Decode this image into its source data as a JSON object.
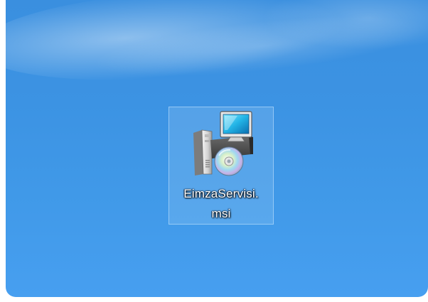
{
  "desktop": {
    "wallpaper_colors": [
      "#3a8fdf",
      "#479ff0"
    ],
    "icons": [
      {
        "icon_name": "msi-installer-icon",
        "label_line1": "EimzaServisi.",
        "label_line2": "msi",
        "selected": true
      }
    ]
  }
}
